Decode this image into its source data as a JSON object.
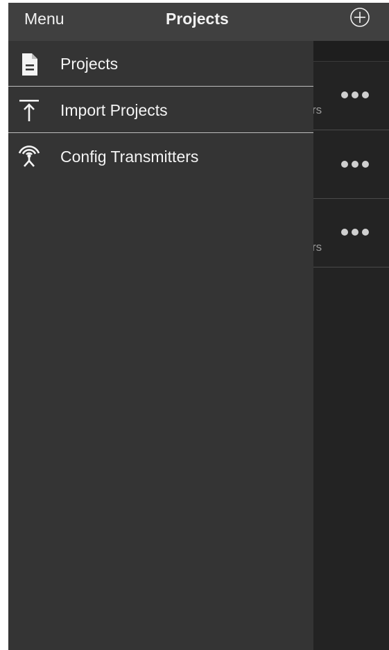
{
  "navbar": {
    "menu_label": "Menu",
    "title": "Projects",
    "add_icon": "plus-circle-icon"
  },
  "drawer": {
    "items": [
      {
        "label": "Projects",
        "icon": "document-icon"
      },
      {
        "label": "Import Projects",
        "icon": "upload-arrow-icon"
      },
      {
        "label": "Config Transmitters",
        "icon": "antenna-icon"
      }
    ]
  },
  "background_list": {
    "rows": [
      {
        "visible_fragment": "rs",
        "more_icon": "more-dots-icon"
      },
      {
        "visible_fragment": "",
        "more_icon": "more-dots-icon"
      },
      {
        "visible_fragment": "rs",
        "more_icon": "more-dots-icon"
      }
    ]
  },
  "colors": {
    "navbar": "#404040",
    "drawer": "#343434",
    "list_background": "#232323",
    "divider": "#bdbdbd",
    "text": "#f4f4f4"
  }
}
